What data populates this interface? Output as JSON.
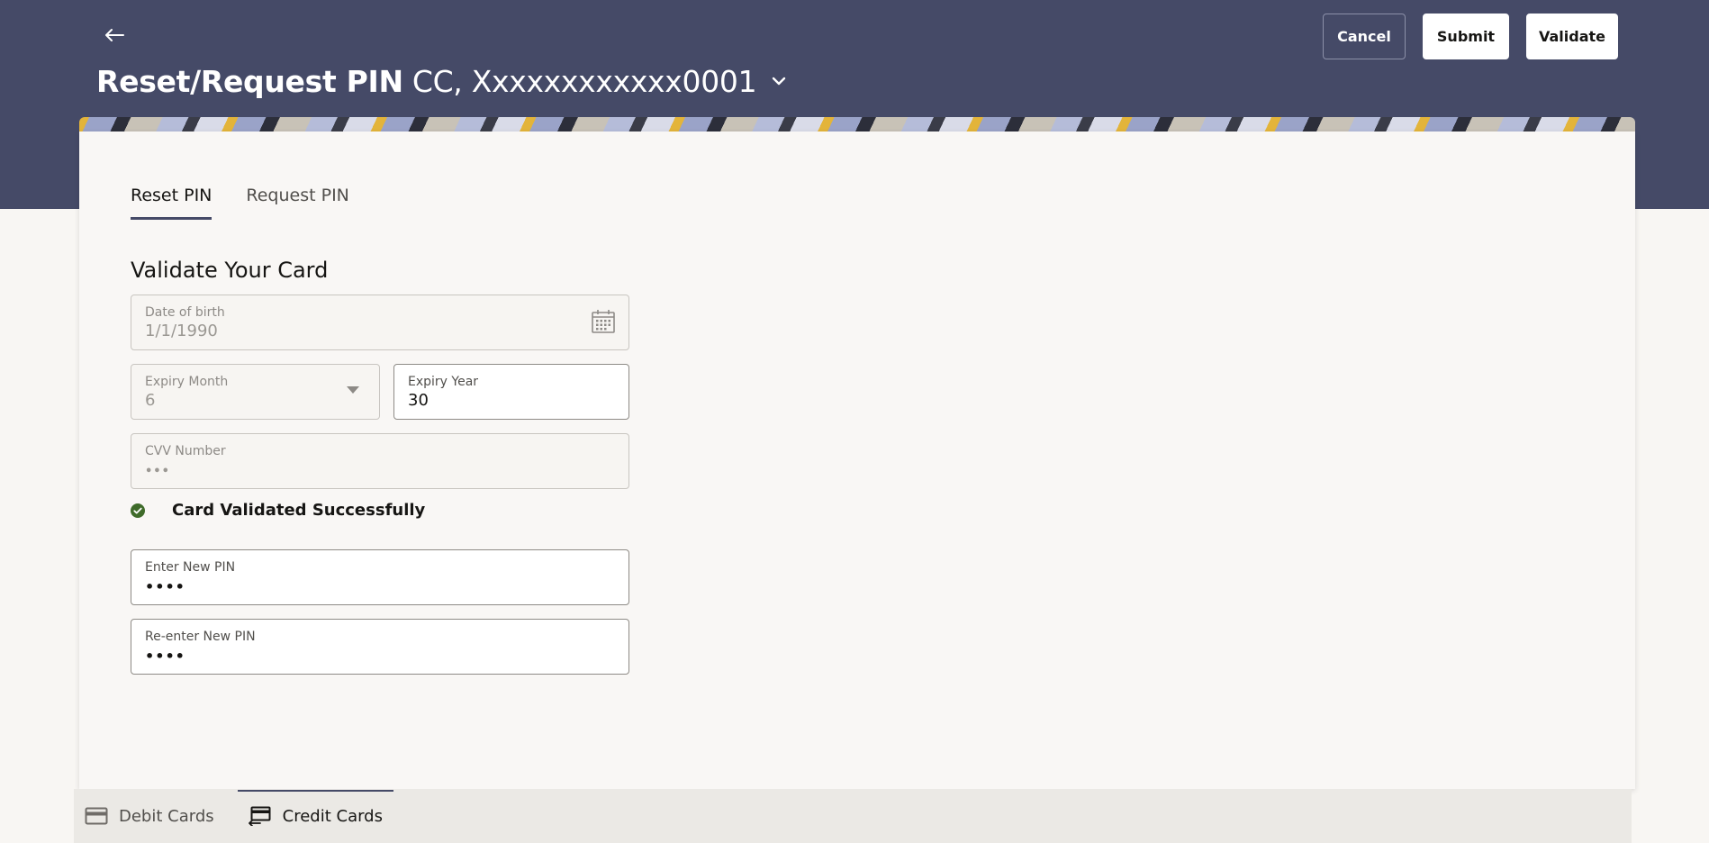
{
  "header": {
    "back_icon": "arrow-left-icon",
    "title_main": "Reset/Request PIN",
    "title_account": "CC, Xxxxxxxxxxxx0001",
    "account_dropdown_icon": "chevron-down-icon",
    "buttons": {
      "cancel": "Cancel",
      "submit": "Submit",
      "validate": "Validate"
    }
  },
  "tabs": [
    {
      "label": "Reset PIN",
      "active": true
    },
    {
      "label": "Request PIN",
      "active": false
    }
  ],
  "form": {
    "section_title": "Validate Your Card",
    "date_of_birth": {
      "label": "Date of birth",
      "value": "1/1/1990",
      "icon": "calendar-icon"
    },
    "expiry_month": {
      "label": "Expiry Month",
      "value": "6",
      "icon": "caret-down-icon"
    },
    "expiry_year": {
      "label": "Expiry Year",
      "value": "30"
    },
    "cvv": {
      "label": "CVV Number",
      "value": "•••"
    },
    "status": {
      "icon": "check-circle-icon",
      "message": "Card Validated Successfully"
    },
    "new_pin": {
      "label": "Enter New PIN",
      "value": "••••"
    },
    "reenter_pin": {
      "label": "Re-enter New PIN",
      "value": "••••"
    }
  },
  "bottom_tabs": [
    {
      "label": "Debit Cards",
      "icon": "debit-card-icon",
      "active": false
    },
    {
      "label": "Credit Cards",
      "icon": "credit-card-icon",
      "active": true
    }
  ],
  "colors": {
    "header_bg": "#454a67",
    "success": "#3f6b2a",
    "page_bg": "#f8f6f3"
  }
}
